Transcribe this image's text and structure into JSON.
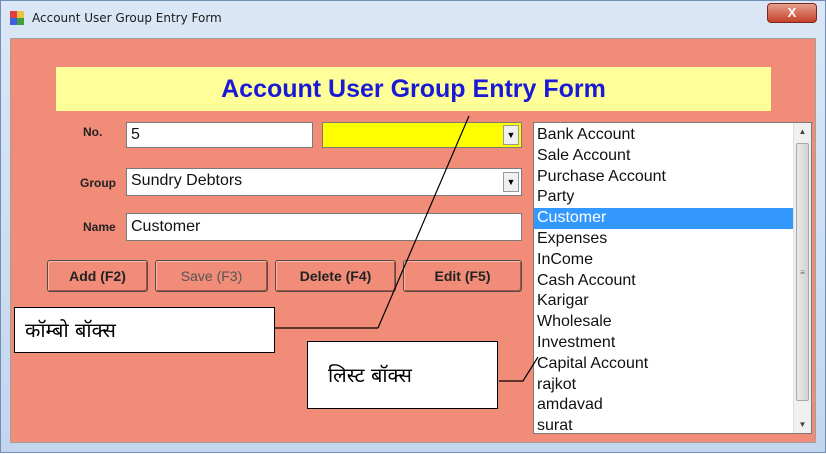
{
  "window": {
    "title": "Account User Group Entry Form",
    "close_glyph": "X"
  },
  "form": {
    "heading": "Account User Group Entry Form",
    "no_label": "No.",
    "no_value": "5",
    "group_label": "Group",
    "group_value": "Sundry Debtors",
    "name_label": "Name",
    "name_value": "Customer",
    "yellow_combo_value": ""
  },
  "buttons": {
    "add": "Add (F2)",
    "save": "Save (F3)",
    "delete": "Delete (F4)",
    "edit": "Edit (F5)"
  },
  "list": {
    "items": [
      "Bank Account",
      "Sale Account",
      "Purchase Account",
      "Party",
      "Customer",
      "Expenses",
      "InCome",
      "Cash Account",
      "Karigar",
      "Wholesale",
      "Investment",
      "Capital Account",
      "rajkot",
      "amdavad",
      "surat"
    ],
    "selected_index": 4
  },
  "annotations": {
    "combo_box": "कॉम्बो बॉक्स",
    "list_box": "लिस्ट बॉक्स"
  },
  "colors": {
    "form_background": "#f08c78",
    "heading_band": "#ffff99",
    "heading_text": "#1a1ad6",
    "combo_yellow": "#ffff00",
    "selection": "#3399ff"
  }
}
